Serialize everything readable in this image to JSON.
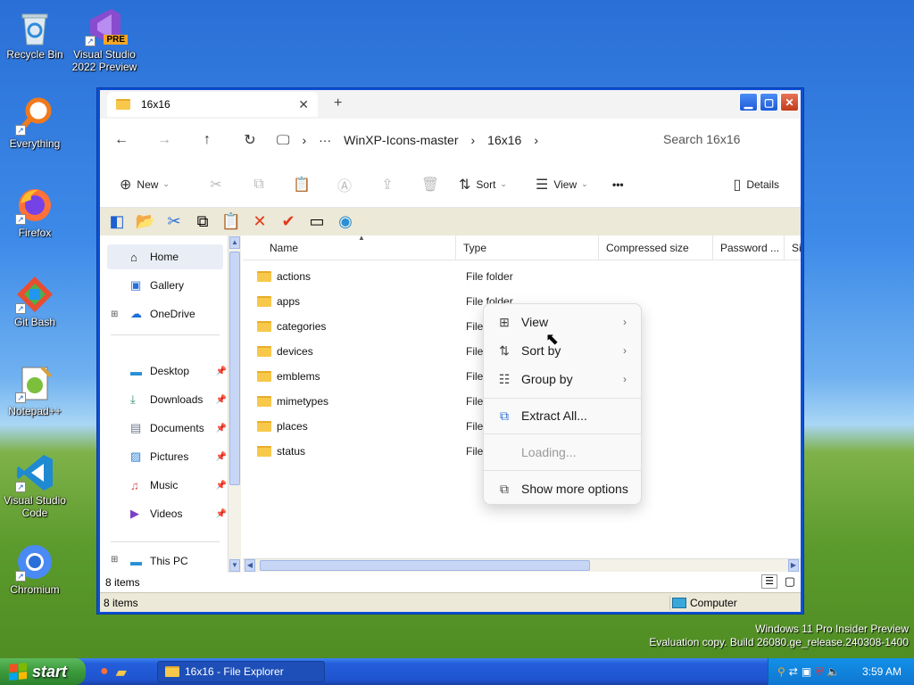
{
  "desktop": {
    "icons": [
      {
        "label": "Recycle Bin",
        "icon": "recycle-bin-icon"
      },
      {
        "label": "Visual Studio 2022 Preview",
        "badge": "PRE",
        "icon": "visual-studio-icon"
      },
      {
        "label": "Everything",
        "icon": "everything-search-icon"
      },
      {
        "label": "Firefox",
        "icon": "firefox-icon"
      },
      {
        "label": "Git Bash",
        "icon": "git-bash-icon"
      },
      {
        "label": "Notepad++",
        "icon": "notepadpp-icon"
      },
      {
        "label": "Visual Studio Code",
        "icon": "vscode-icon"
      },
      {
        "label": "Chromium",
        "icon": "chromium-icon"
      }
    ],
    "watermark_line1": "Windows 11 Pro Insider Preview",
    "watermark_line2": "Evaluation copy. Build 26080.ge_release.240308-1400"
  },
  "window": {
    "tab_title": "16x16",
    "address": {
      "crumbs": [
        "WinXP-Icons-master",
        "16x16"
      ],
      "search_placeholder": "Search 16x16"
    },
    "commands": {
      "new": "New",
      "sort": "Sort",
      "view": "View",
      "more": "•••",
      "details": "Details"
    },
    "nav": [
      {
        "label": "Home",
        "icon": "home-icon"
      },
      {
        "label": "Gallery",
        "icon": "gallery-icon"
      },
      {
        "label": "OneDrive",
        "icon": "onedrive-icon"
      },
      {
        "label": "Desktop",
        "icon": "desktop-icon"
      },
      {
        "label": "Downloads",
        "icon": "downloads-icon"
      },
      {
        "label": "Documents",
        "icon": "documents-icon"
      },
      {
        "label": "Pictures",
        "icon": "pictures-icon"
      },
      {
        "label": "Music",
        "icon": "music-icon"
      },
      {
        "label": "Videos",
        "icon": "videos-icon"
      },
      {
        "label": "This PC",
        "icon": "this-pc-icon"
      }
    ],
    "columns": [
      "Name",
      "Type",
      "Compressed size",
      "Password ...",
      "Si"
    ],
    "files": [
      {
        "name": "actions",
        "type": "File folder"
      },
      {
        "name": "apps",
        "type": "File folder"
      },
      {
        "name": "categories",
        "type": "File f"
      },
      {
        "name": "devices",
        "type": "File f"
      },
      {
        "name": "emblems",
        "type": "File f"
      },
      {
        "name": "mimetypes",
        "type": "File f"
      },
      {
        "name": "places",
        "type": "File f"
      },
      {
        "name": "status",
        "type": "File f"
      }
    ],
    "status_count": "8 items",
    "xp_status_count": "8 items",
    "xp_status_location": "Computer"
  },
  "context_menu": {
    "items": [
      {
        "label": "View",
        "has_submenu": true
      },
      {
        "label": "Sort by",
        "has_submenu": true
      },
      {
        "label": "Group by",
        "has_submenu": true
      },
      {
        "label": "Extract All..."
      },
      {
        "label": "Loading...",
        "disabled": true
      },
      {
        "label": "Show more options"
      }
    ]
  },
  "taskbar": {
    "start_label": "start",
    "task_label": "16x16 - File Explorer",
    "clock": "3:59 AM"
  }
}
